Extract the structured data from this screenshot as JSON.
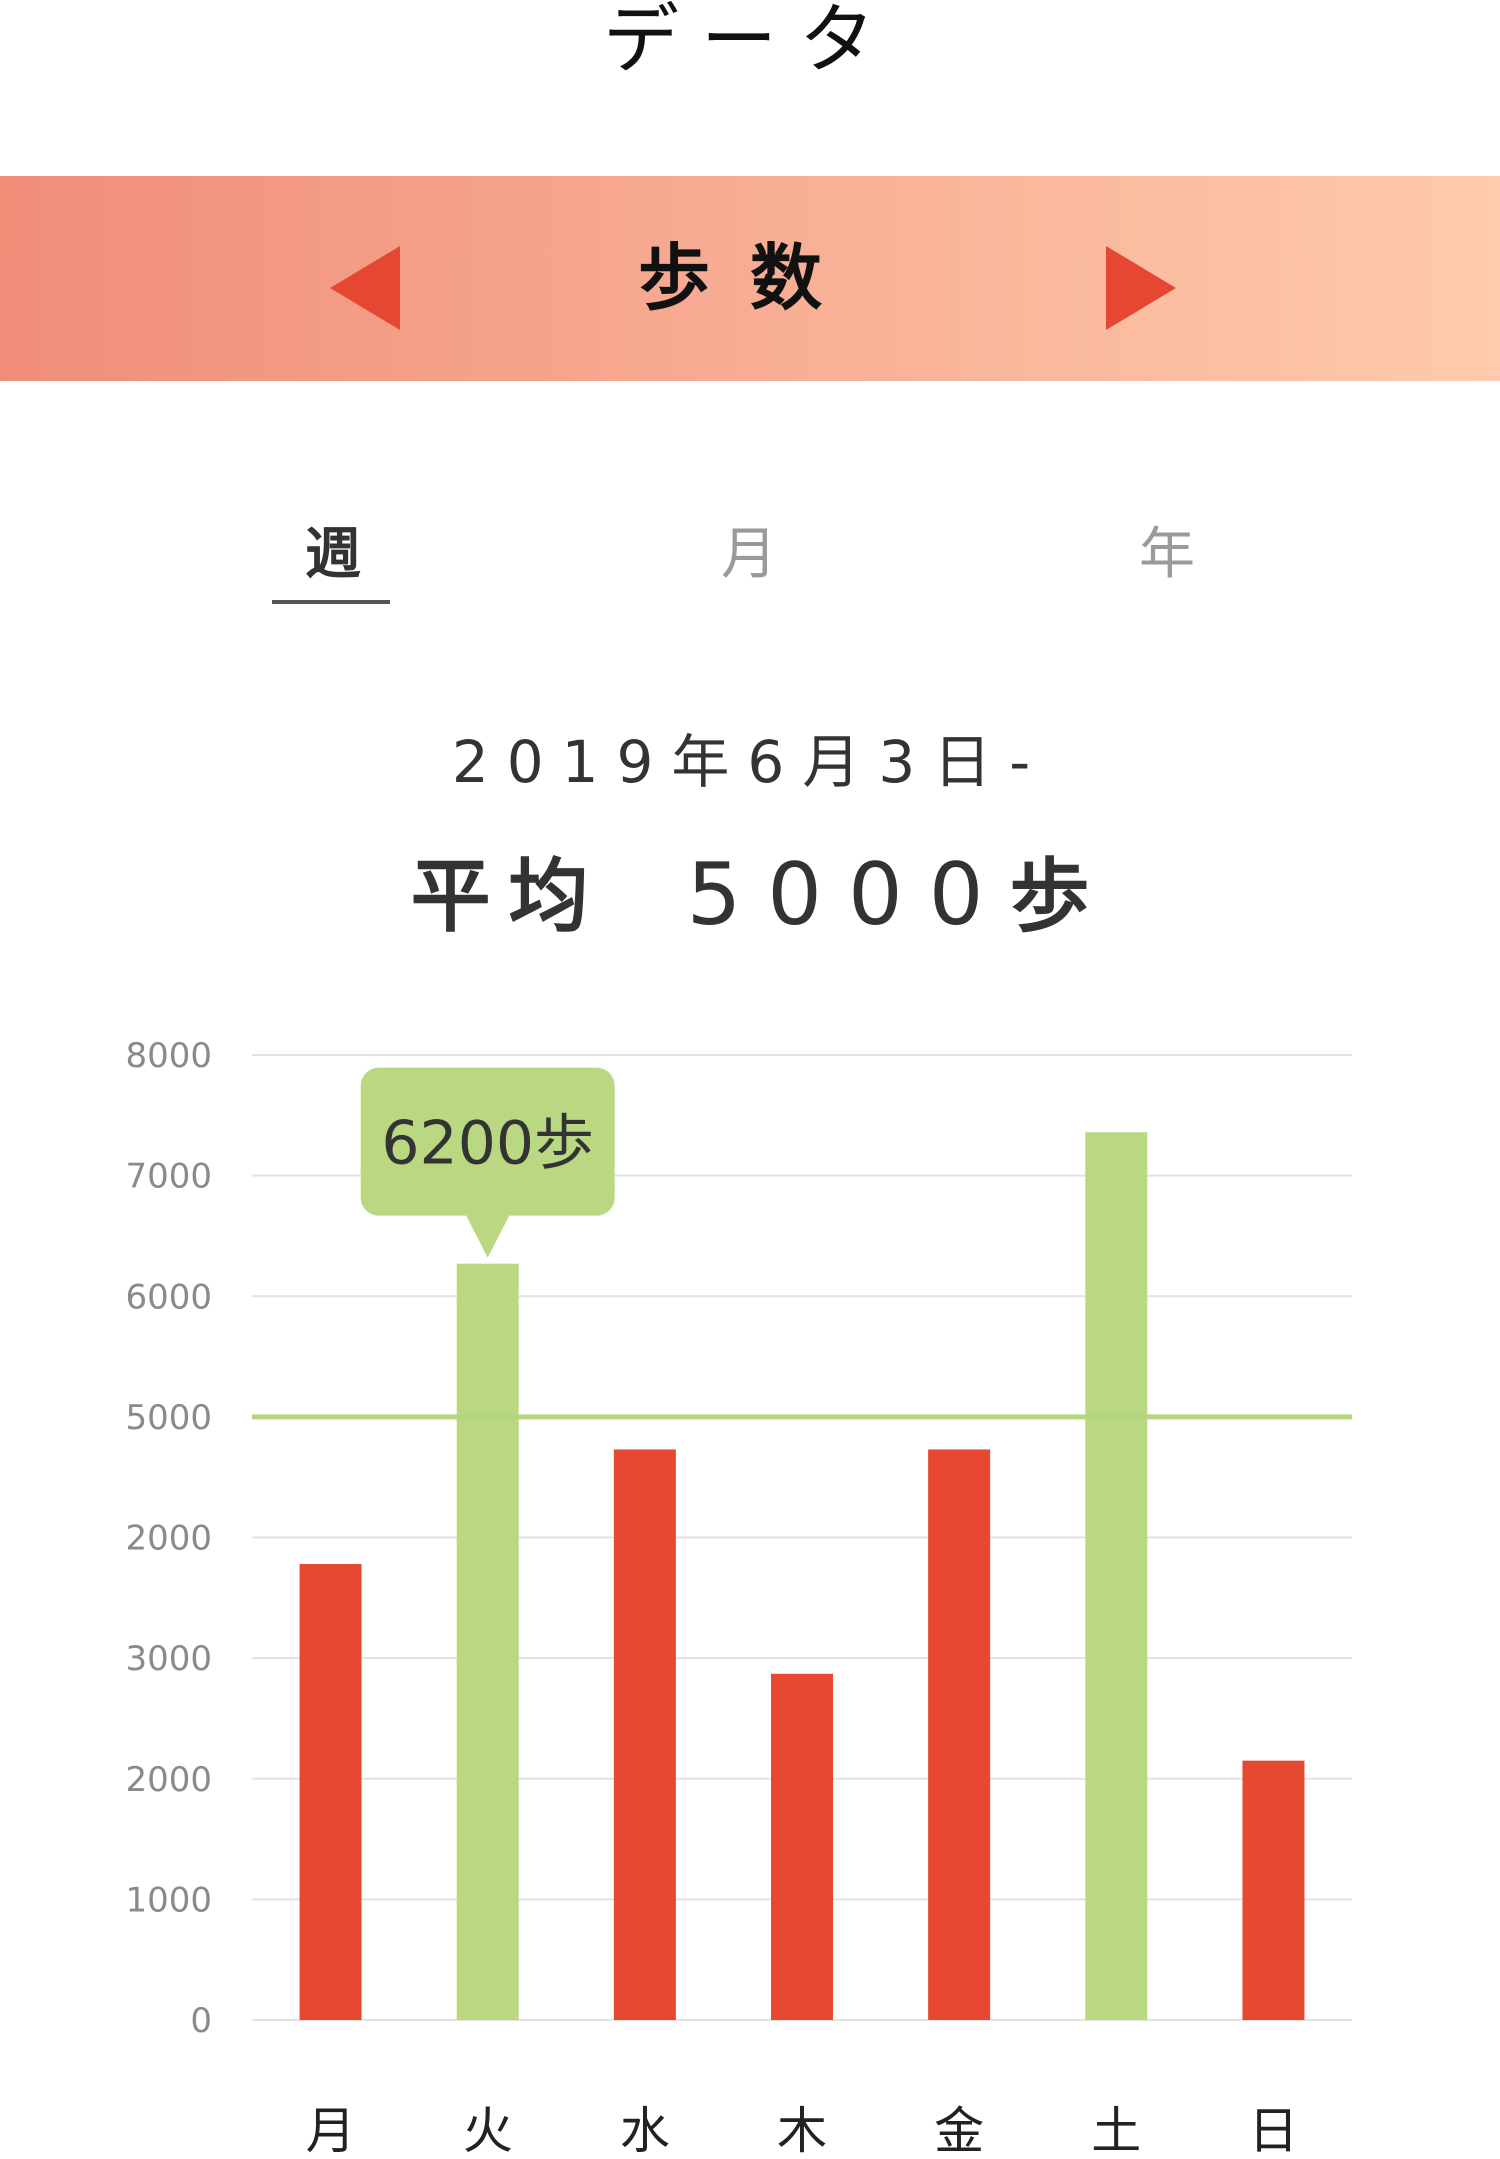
{
  "header": {
    "title": "データ"
  },
  "banner": {
    "title": "歩数",
    "prev_icon": "triangle-left-icon",
    "next_icon": "triangle-right-icon",
    "arrow_color": "#e64733"
  },
  "tabs": [
    {
      "label": "週",
      "active": true
    },
    {
      "label": "月",
      "active": false
    },
    {
      "label": "年",
      "active": false
    }
  ],
  "summary": {
    "range": "2019年6月3日-",
    "average_label": "平均",
    "average_value": "5000",
    "average_unit": "歩"
  },
  "chart_data": {
    "type": "bar",
    "categories": [
      "月",
      "火",
      "水",
      "木",
      "金",
      "土",
      "日"
    ],
    "values": [
      3780,
      6270,
      4730,
      2870,
      4730,
      7360,
      2150
    ],
    "highlighted": [
      false,
      true,
      false,
      false,
      false,
      true,
      false
    ],
    "y_tick_labels": [
      "0",
      "1000",
      "2000",
      "3000",
      "2000",
      "5000",
      "6000",
      "7000",
      "8000"
    ],
    "ylim": [
      0,
      8000
    ],
    "reference_line": {
      "value": 5000
    },
    "tooltip": {
      "category": "火",
      "label": "6200歩"
    },
    "colors": {
      "normal": "#e64832",
      "highlight": "#bad882",
      "reference_line": "#b3d57c",
      "tooltip_bg": "#bad882",
      "grid": "#e3e3e3"
    },
    "grid": true
  }
}
